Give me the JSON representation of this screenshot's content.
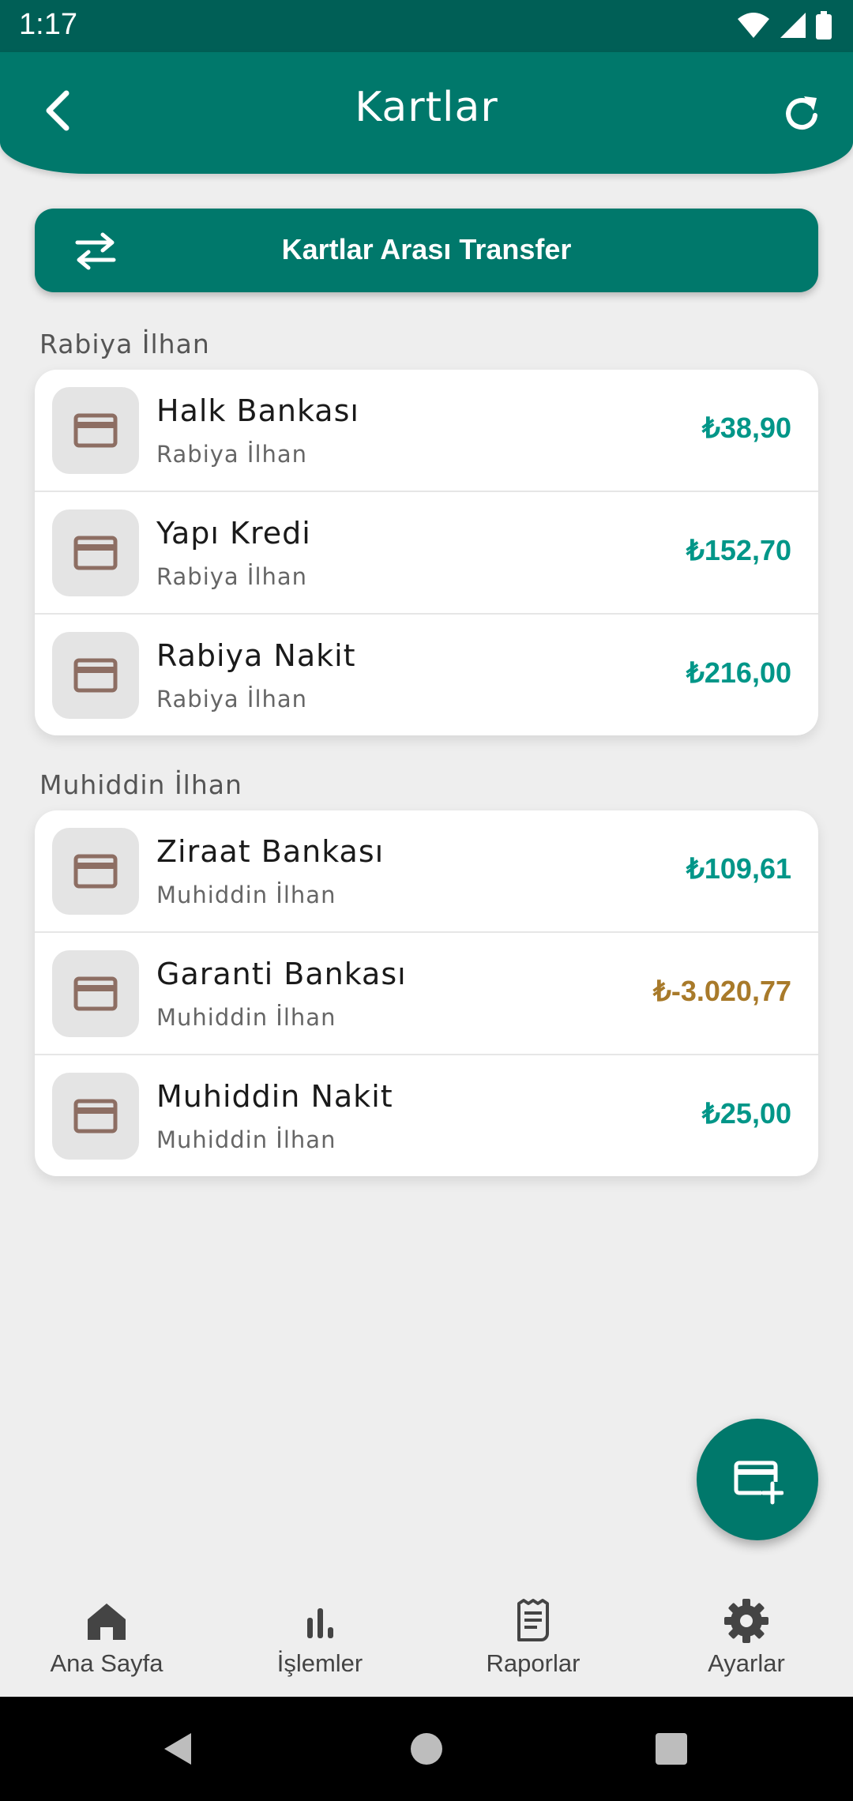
{
  "status_bar": {
    "time": "1:17"
  },
  "header": {
    "title": "Kartlar"
  },
  "transfer_button": {
    "label": "Kartlar Arası Transfer"
  },
  "colors": {
    "primary": "#00786b",
    "positive": "#009688",
    "negative": "#a87a2a",
    "icon_brown": "#8d6e63"
  },
  "groups": [
    {
      "title": "Rabiya İlhan",
      "cards": [
        {
          "name": "Halk Bankası",
          "owner": "Rabiya İlhan",
          "amount": "₺38,90",
          "negative": false
        },
        {
          "name": "Yapı Kredi",
          "owner": "Rabiya İlhan",
          "amount": "₺152,70",
          "negative": false
        },
        {
          "name": "Rabiya Nakit",
          "owner": "Rabiya İlhan",
          "amount": "₺216,00",
          "negative": false
        }
      ]
    },
    {
      "title": "Muhiddin İlhan",
      "cards": [
        {
          "name": "Ziraat Bankası",
          "owner": "Muhiddin İlhan",
          "amount": "₺109,61",
          "negative": false
        },
        {
          "name": "Garanti Bankası",
          "owner": "Muhiddin İlhan",
          "amount": "₺-3.020,77",
          "negative": true
        },
        {
          "name": "Muhiddin Nakit",
          "owner": "Muhiddin İlhan",
          "amount": "₺25,00",
          "negative": false
        }
      ]
    }
  ],
  "bottom_nav": [
    {
      "label": "Ana Sayfa",
      "icon": "home-icon"
    },
    {
      "label": "İşlemler",
      "icon": "bar-chart-icon"
    },
    {
      "label": "Raporlar",
      "icon": "receipt-icon"
    },
    {
      "label": "Ayarlar",
      "icon": "gear-icon"
    }
  ]
}
